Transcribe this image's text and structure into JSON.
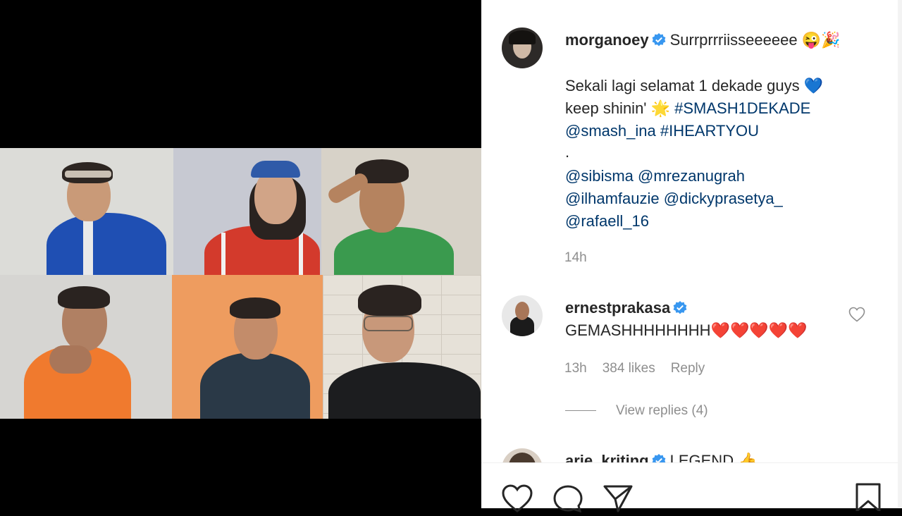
{
  "post": {
    "author": "morganoey",
    "caption_line1": "Surrprrriisseeeeee 😜🎉",
    "caption_line2": "Sekali lagi selamat 1 dekade guys 💙",
    "caption_line3_text": "keep shinin' 🌟 ",
    "caption_line3_tag": "#SMASH1DEKADE",
    "caption_line4_mention": "@smash_ina",
    "caption_line4_tag": "#IHEARTYOU",
    "caption_dot": ".",
    "mentions_line1": "@sibisma @mrezanugrah",
    "mentions_line2": "@ilhamfauzie @dickyprasetya_",
    "mentions_line3": "@rafaell_16",
    "time": "14h"
  },
  "comments": [
    {
      "username": "ernestprakasa",
      "text": "GEMASHHHHHHHH❤️❤️❤️❤️❤️",
      "time": "13h",
      "likes": "384 likes",
      "reply_label": "Reply",
      "view_replies": "View replies (4)"
    },
    {
      "username": "arie_kriting",
      "text": "LEGEND 👍"
    }
  ],
  "icons": {
    "like": "heart-icon",
    "comment": "comment-bubble-icon",
    "share": "paper-plane-icon",
    "save": "bookmark-icon",
    "verified": "verified-badge-icon"
  },
  "colors": {
    "verified": "#3897f0",
    "link": "#00376b",
    "muted": "#8e8e8e"
  }
}
